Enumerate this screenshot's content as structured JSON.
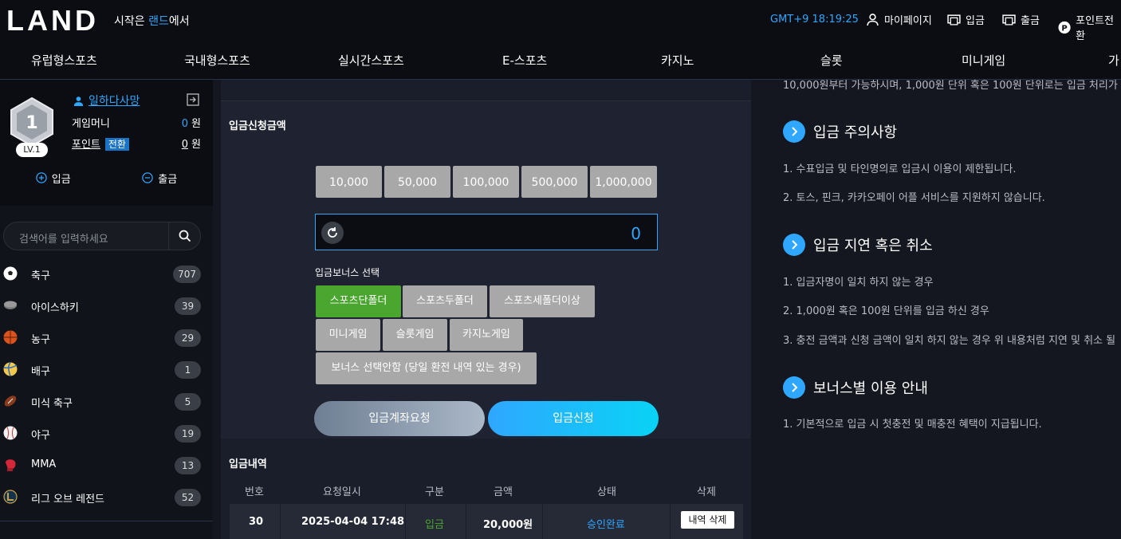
{
  "header": {
    "logo": "LAND",
    "slogan_prefix": "시작은 ",
    "slogan_highlight": "랜드",
    "slogan_suffix": "에서",
    "clock": "GMT+9 18:19:25",
    "nav": [
      {
        "label": "마이페이지",
        "icon": "user-icon"
      },
      {
        "label": "입금",
        "icon": "deposit-icon"
      },
      {
        "label": "출금",
        "icon": "withdraw-icon"
      },
      {
        "label": "포인트전환",
        "icon": "point-icon"
      }
    ],
    "accent_color": "#2fa7ff"
  },
  "menu": [
    "유럽형스포츠",
    "국내형스포츠",
    "실시간스포츠",
    "E-스포츠",
    "카지노",
    "슬롯",
    "미니게임",
    "가"
  ],
  "profile": {
    "level_number": "1",
    "level_label": "LV.1",
    "username": "일하다사망",
    "game_money_label": "게임머니",
    "game_money_value": "0",
    "point_label": "포인트",
    "convert_label": "전환",
    "point_value": "0",
    "unit": "원",
    "deposit_label": "입금",
    "withdraw_label": "출금"
  },
  "search": {
    "placeholder": "검색어를 입력하세요"
  },
  "sports": [
    {
      "name": "축구",
      "count": "707",
      "icon": "soccer-ball-icon"
    },
    {
      "name": "아이스하키",
      "count": "39",
      "icon": "hockey-puck-icon"
    },
    {
      "name": "농구",
      "count": "29",
      "icon": "basketball-icon"
    },
    {
      "name": "배구",
      "count": "1",
      "icon": "volleyball-icon"
    },
    {
      "name": "미식 축구",
      "count": "5",
      "icon": "football-icon"
    },
    {
      "name": "야구",
      "count": "19",
      "icon": "baseball-icon"
    },
    {
      "name": "MMA",
      "count": "13",
      "icon": "boxing-glove-icon"
    },
    {
      "name": "리그 오브 레전드",
      "count": "52",
      "icon": "lol-icon"
    }
  ],
  "deposit_form": {
    "title": "입금신청금액",
    "amount_buttons": [
      "10,000",
      "50,000",
      "100,000",
      "500,000",
      "1,000,000"
    ],
    "amount_value": "0",
    "bonus_label": "입금보너스 선택",
    "bonus_options": [
      "스포츠단폴더",
      "스포츠두폴더",
      "스포츠세폴더이상",
      "미니게임",
      "슬롯게임",
      "카지노게임",
      "보너스 선택안함 (당일 환전 내역 있는 경우)"
    ],
    "selected_bonus": "스포츠단폴더",
    "account_request_label": "입금계좌요청",
    "submit_label": "입금신청"
  },
  "history": {
    "title": "입금내역",
    "columns": [
      "번호",
      "요청일시",
      "구분",
      "금액",
      "상태",
      "삭제"
    ],
    "rows": [
      {
        "no": "30",
        "datetime": "2025-04-04 17:48",
        "type": "입금",
        "amount": "20,000원",
        "status": "승인완료",
        "delete_label": "내역 삭제"
      }
    ]
  },
  "notices": {
    "top_line": "10,000원부터 가능하시며, 1,000원 단위 혹은 100원 단위로는 입금 처리가",
    "sections": [
      {
        "title": "입금 주의사항",
        "lines": [
          "1. 수표입금 및 타인명의로 입금시 이용이 제한됩니다.",
          "2. 토스, 핀크, 카카오페이 어플 서비스를 지원하지 않습니다."
        ]
      },
      {
        "title": "입금 지연 혹은 취소",
        "lines": [
          "1. 입금자명이 일치 하지 않는 경우",
          "2. 1,000원 혹은 100원 단위를 입금 하신 경우",
          "3. 충전 금액과 신청 금액이 일치 하지 않는 경우 위 내용처럼 지연 및 취소 될"
        ]
      },
      {
        "title": "보너스별 이용 안내",
        "lines": [
          "1. 기본적으로 입금 시 첫충전 및 매충전 혜택이 지급됩니다."
        ]
      }
    ]
  }
}
